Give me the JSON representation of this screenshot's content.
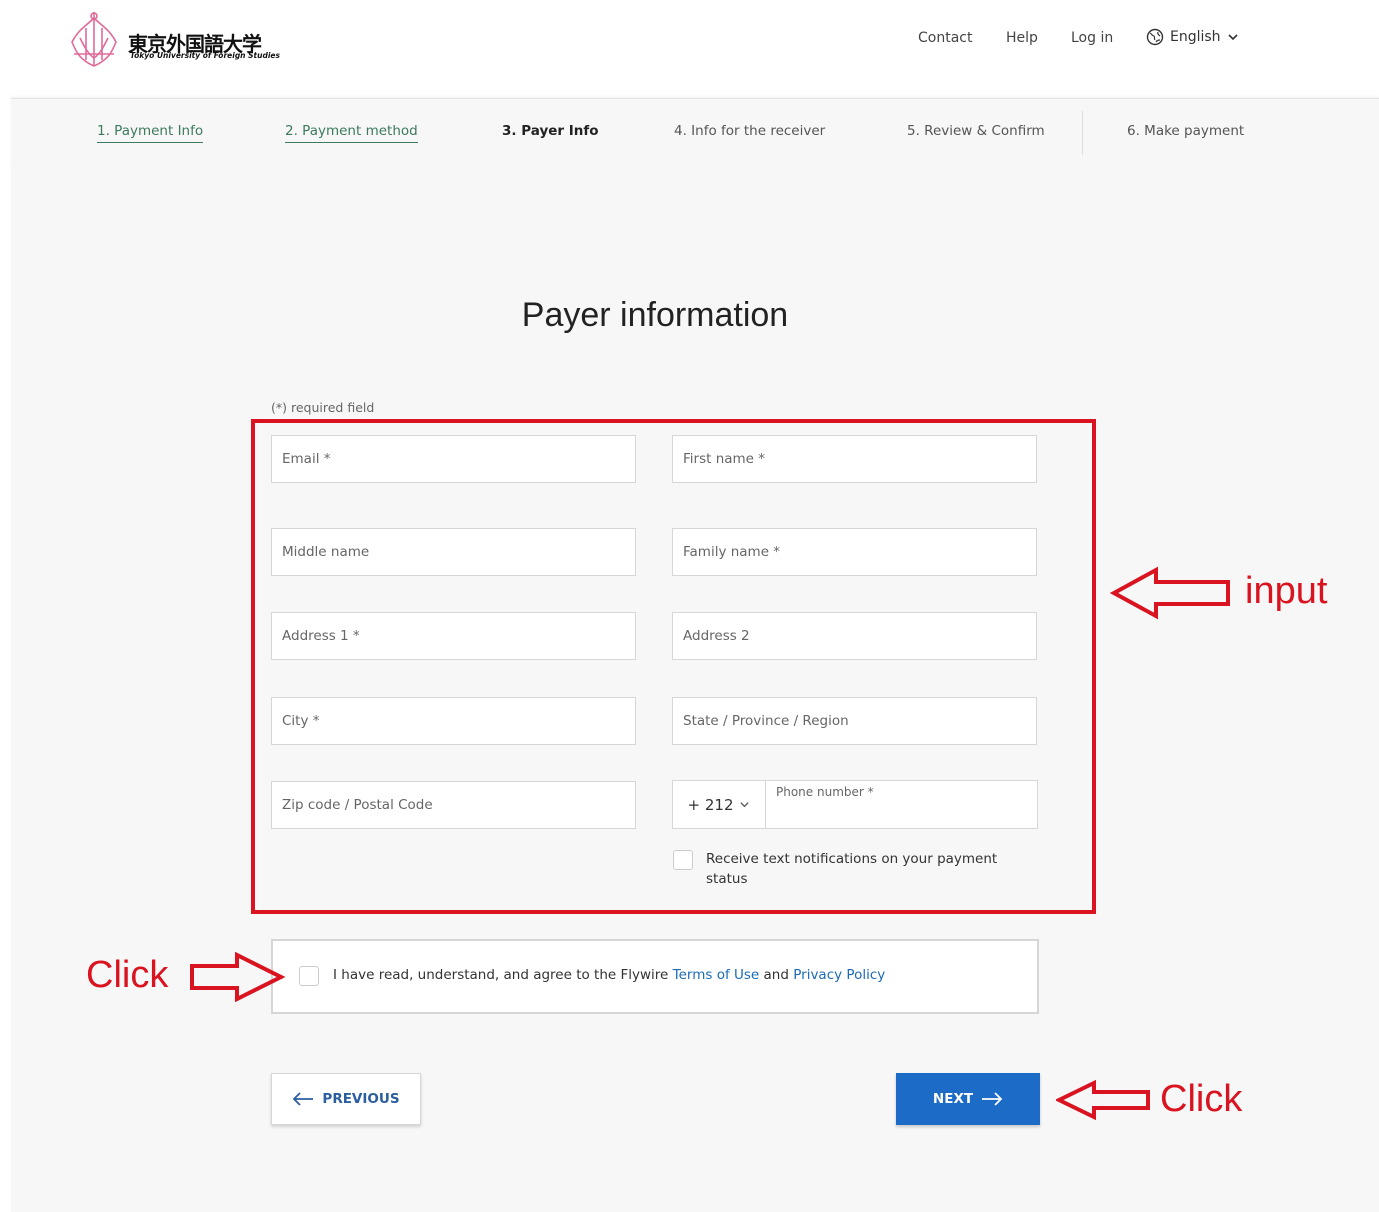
{
  "header": {
    "logo_jp": "東京外国語大学",
    "logo_en": "Tokyo University of Foreign Studies",
    "nav": [
      "Contact",
      "Help",
      "Log in"
    ],
    "language": "English"
  },
  "steps": [
    "1. Payment Info",
    "2. Payment method",
    "3. Payer Info",
    "4. Info for the receiver",
    "5. Review & Confirm",
    "6. Make payment"
  ],
  "form": {
    "title": "Payer information",
    "required_note": "(*) required field",
    "fields": {
      "email": "Email *",
      "first_name": "First name *",
      "middle_name": "Middle name",
      "family_name": "Family name *",
      "address1": "Address 1 *",
      "address2": "Address 2",
      "city": "City *",
      "state": "State / Province / Region",
      "zip": "Zip code / Postal Code"
    },
    "phone": {
      "code": "+ 212",
      "label": "Phone number *"
    },
    "notify_text": "Receive text notifications on your payment status",
    "agree": {
      "prefix": "I have read, understand, and agree to the Flywire",
      "terms": "Terms of Use",
      "and": "and",
      "privacy": "Privacy Policy"
    }
  },
  "buttons": {
    "previous": "PREVIOUS",
    "next": "NEXT"
  },
  "annotations": {
    "input": "input",
    "click_left": "Click",
    "click_right": "Click"
  },
  "colors": {
    "annotation_red": "#d9131f",
    "primary_blue": "#1c6bc7",
    "step_done_green": "#3d7a5e"
  }
}
